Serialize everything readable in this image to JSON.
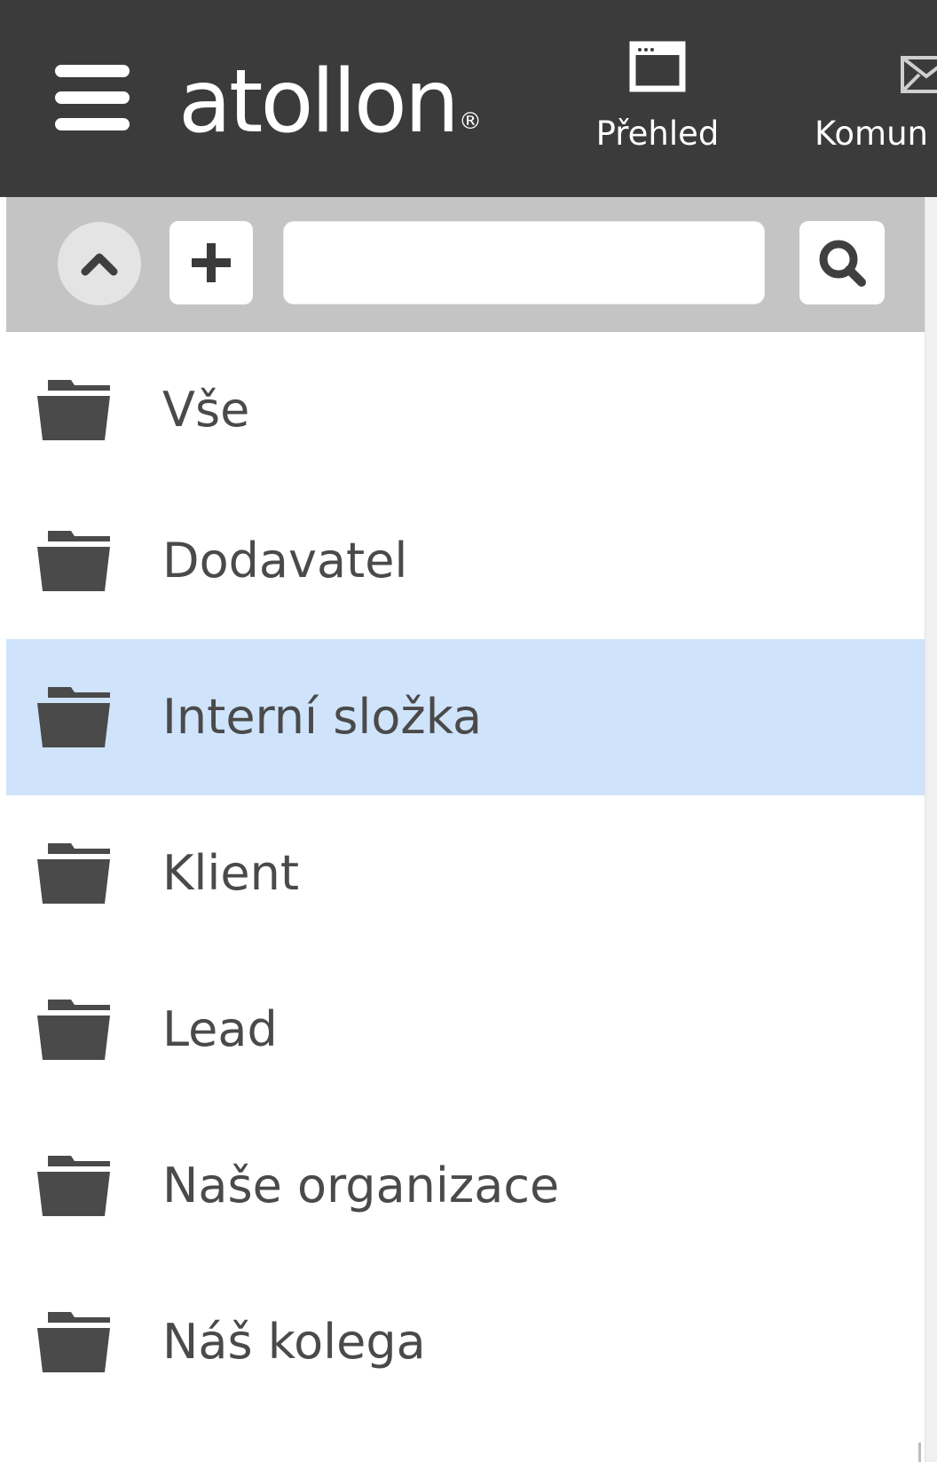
{
  "app": {
    "logo_text": "atollon",
    "logo_mark": "®"
  },
  "topbar": {
    "menu_icon": "hamburger-menu-icon",
    "nav": [
      {
        "label": "Přehled",
        "icon": "window-icon"
      },
      {
        "label": "Komun",
        "icon": "envelope-icon"
      }
    ]
  },
  "toolbar": {
    "collapse_icon": "chevron-up-icon",
    "add_icon": "plus-icon",
    "search_value": "",
    "search_placeholder": "",
    "search_icon": "search-icon"
  },
  "folders": {
    "items": [
      {
        "label": "Vše",
        "icon": "folder-icon",
        "selected": false
      },
      {
        "label": "Dodavatel",
        "icon": "folder-icon",
        "selected": false
      },
      {
        "label": "Interní složka",
        "icon": "folder-icon",
        "selected": true
      },
      {
        "label": "Klient",
        "icon": "folder-icon",
        "selected": false
      },
      {
        "label": "Lead",
        "icon": "folder-icon",
        "selected": false
      },
      {
        "label": "Naše organizace",
        "icon": "folder-icon",
        "selected": false
      },
      {
        "label": "Náš kolega",
        "icon": "folder-icon",
        "selected": false
      }
    ]
  },
  "colors": {
    "topbar_bg": "#3b3b3b",
    "toolbar_bg": "#c4c4c4",
    "selected_bg": "#cfe4fb",
    "text": "#4a4a4a",
    "icon": "#4a4a4a"
  }
}
